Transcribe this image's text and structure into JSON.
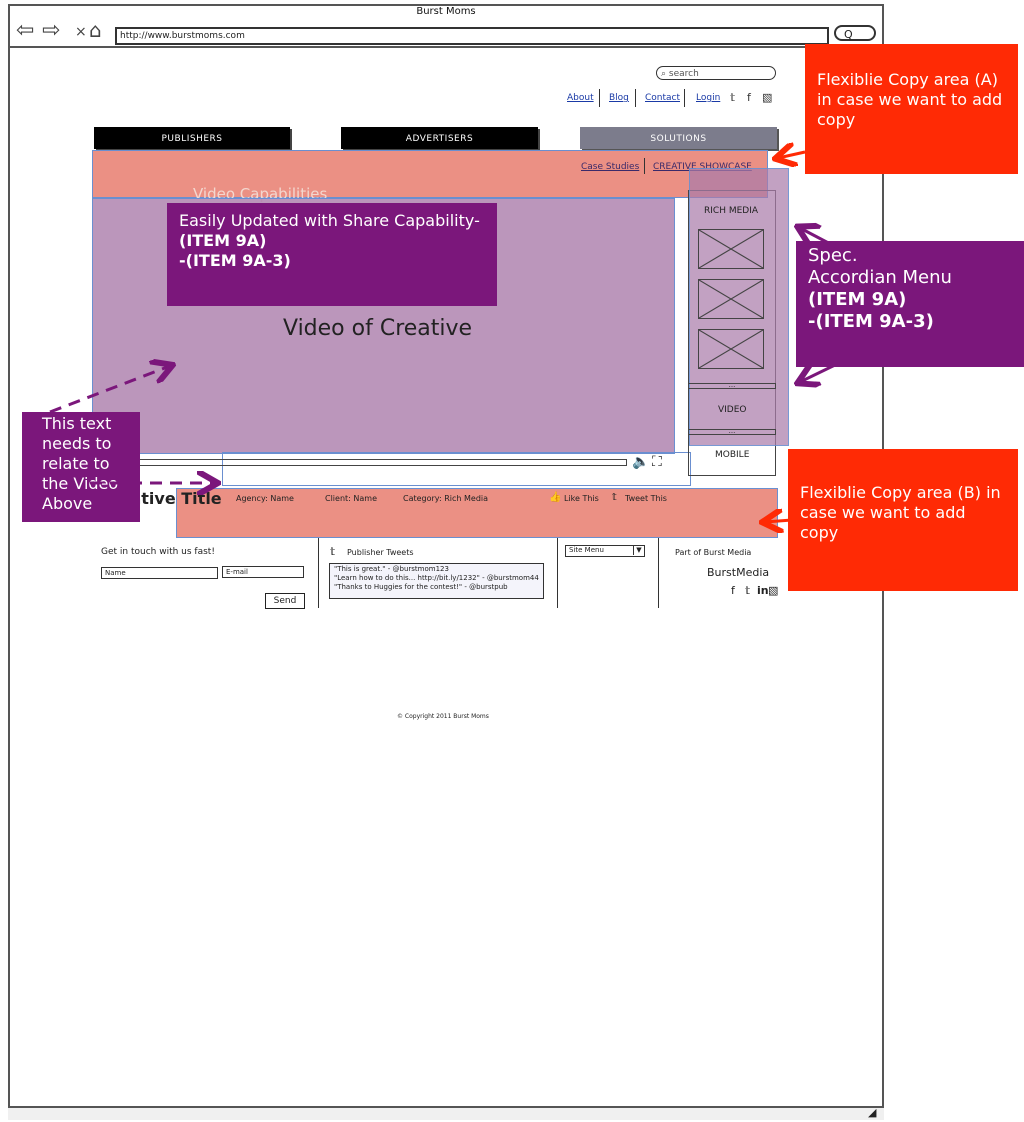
{
  "window": {
    "title": "Burst Moms",
    "url": "http://www.burstmoms.com",
    "go_symbol": "Q"
  },
  "search": {
    "placeholder": "search"
  },
  "top_links": [
    "About",
    "Blog",
    "Contact",
    "Login"
  ],
  "tabs": [
    "PUBLISHERS",
    "ADVERTISERS",
    "SOLUTIONS"
  ],
  "subnav": {
    "case_studies": "Case Studies",
    "creative_showcase": "CREATIVE SHOWCASE"
  },
  "faded_heading": "Video Capabilities",
  "video": {
    "label": "Video of Creative"
  },
  "sidebar": {
    "rich_media": "RICH MEDIA",
    "dots1": "...",
    "video": "VIDEO",
    "dots2": "...",
    "mobile": "MOBILE"
  },
  "info_bar": {
    "title": "Creative Title",
    "agency": "Agency: Name",
    "client": "Client: Name",
    "category": "Category:  Rich Media",
    "like": "Like This",
    "tweet": "Tweet This"
  },
  "footer": {
    "contact_heading": "Get in touch with us fast!",
    "name_placeholder": "Name",
    "email_placeholder": "E-mail",
    "send": "Send",
    "tweets_heading": "Publisher Tweets",
    "tweets": [
      "\"This is great.\" - @burstmom123",
      "\"Learn how to do this... http://bit.ly/1232\" - @burstmom44",
      "\"Thanks to Huggies for the contest!\" - @burstpub"
    ],
    "site_menu": "Site Menu",
    "part_of": "Part of Burst Media",
    "brand": "BurstMedia",
    "copyright": "© Copyright 2011 Burst Moms"
  },
  "notes": {
    "copy_a": "Flexiblie Copy area (A) in case we want to add copy",
    "copy_b": "Flexiblie Copy area (B) in case we want to add copy",
    "easily_line1": "Easily Updated with Share Capability-",
    "item_9a": "(ITEM 9A)",
    "item_9a3": "-(ITEM 9A-3)",
    "spec_line1": "Spec.",
    "spec_line2": "Accordian Menu",
    "text_note": "This text needs to relate to the Video Above"
  },
  "colors": {
    "copy_area": "#ff2a05",
    "note_purple": "#7b177b",
    "salmon": "#e87c6e",
    "video_purple": "#aa7caa"
  }
}
